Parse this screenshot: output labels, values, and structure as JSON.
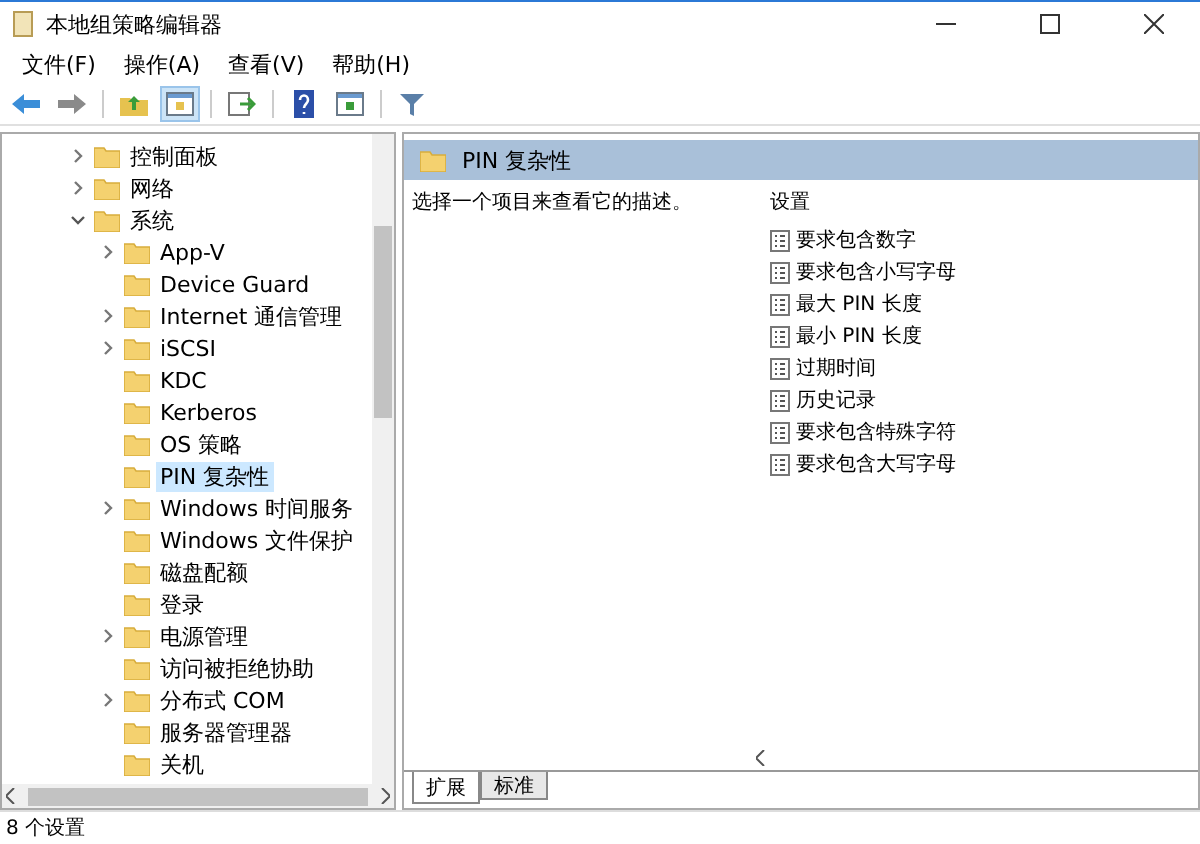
{
  "window": {
    "title": "本地组策略编辑器"
  },
  "menu": [
    "文件(F)",
    "操作(A)",
    "查看(V)",
    "帮助(H)"
  ],
  "tree": [
    {
      "label": "控制面板",
      "kind": "branch",
      "expanded": false,
      "selected": false
    },
    {
      "label": "网络",
      "kind": "branch",
      "expanded": false,
      "selected": false
    },
    {
      "label": "系统",
      "kind": "branch",
      "expanded": true,
      "selected": false,
      "children": [
        {
          "label": "App-V",
          "kind": "branch",
          "expanded": false,
          "selected": false
        },
        {
          "label": "Device Guard",
          "kind": "leaf",
          "selected": false
        },
        {
          "label": "Internet 通信管理",
          "kind": "branch",
          "expanded": false,
          "selected": false
        },
        {
          "label": "iSCSI",
          "kind": "branch",
          "expanded": false,
          "selected": false
        },
        {
          "label": "KDC",
          "kind": "leaf",
          "selected": false
        },
        {
          "label": "Kerberos",
          "kind": "leaf",
          "selected": false
        },
        {
          "label": "OS 策略",
          "kind": "leaf",
          "selected": false
        },
        {
          "label": "PIN 复杂性",
          "kind": "leaf",
          "selected": true
        },
        {
          "label": "Windows 时间服务",
          "kind": "branch",
          "expanded": false,
          "selected": false
        },
        {
          "label": "Windows 文件保护",
          "kind": "leaf",
          "selected": false
        },
        {
          "label": "磁盘配额",
          "kind": "leaf",
          "selected": false
        },
        {
          "label": "登录",
          "kind": "leaf",
          "selected": false
        },
        {
          "label": "电源管理",
          "kind": "branch",
          "expanded": false,
          "selected": false
        },
        {
          "label": "访问被拒绝协助",
          "kind": "leaf",
          "selected": false
        },
        {
          "label": "分布式 COM",
          "kind": "branch",
          "expanded": false,
          "selected": false
        },
        {
          "label": "服务器管理器",
          "kind": "leaf",
          "selected": false
        },
        {
          "label": "关机",
          "kind": "leaf",
          "selected": false
        }
      ]
    }
  ],
  "detail": {
    "header": "PIN 复杂性",
    "description": "选择一个项目来查看它的描述。",
    "column_heading": "设置",
    "settings": [
      "要求包含数字",
      "要求包含小写字母",
      "最大 PIN 长度",
      "最小 PIN 长度",
      "过期时间",
      "历史记录",
      "要求包含特殊字符",
      "要求包含大写字母"
    ]
  },
  "view_tabs": [
    {
      "label": "扩展",
      "selected": true
    },
    {
      "label": "标准",
      "selected": false
    }
  ],
  "status_bar": "8 个设置"
}
